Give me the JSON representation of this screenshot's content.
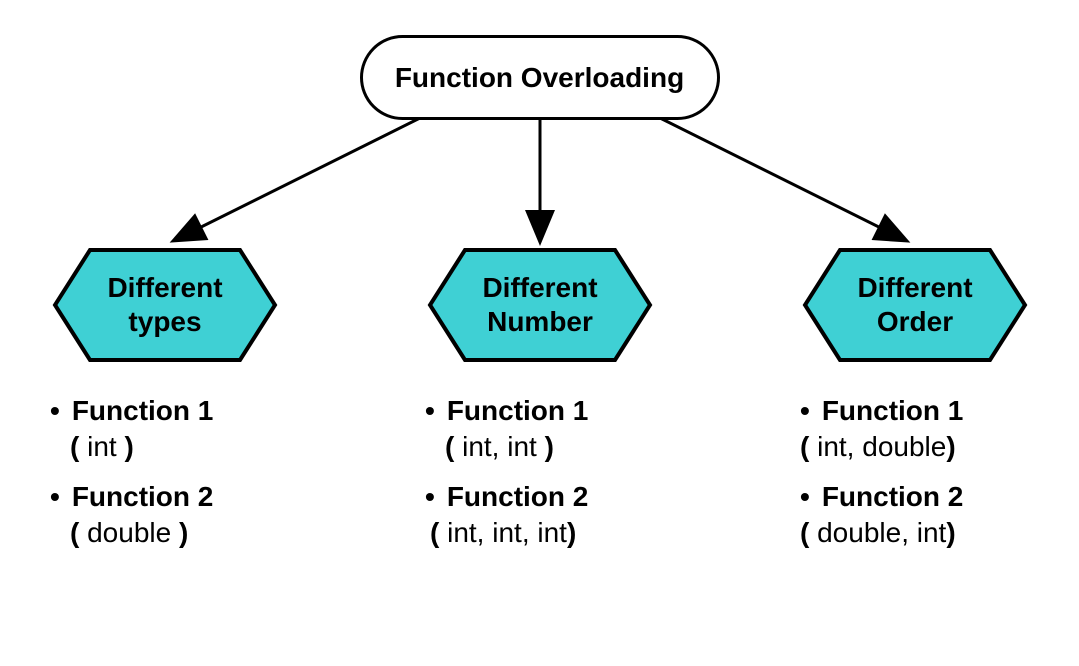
{
  "root": {
    "title": "Function Overloading"
  },
  "columns": [
    {
      "header": "Different\ntypes",
      "items": [
        {
          "name": "Function 1",
          "params": "int"
        },
        {
          "name": "Function 2",
          "params": "double"
        }
      ]
    },
    {
      "header": "Different\nNumber",
      "items": [
        {
          "name": "Function 1",
          "params": "int, int"
        },
        {
          "name": "Function 2",
          "params": "int, int,  int"
        }
      ]
    },
    {
      "header": "Different\nOrder",
      "items": [
        {
          "name": "Function 1",
          "params": "int, double"
        },
        {
          "name": "Function 2",
          "params": "double, int"
        }
      ]
    }
  ],
  "styles": {
    "hexFill": "#3fd0d4",
    "hexStroke": "#000000"
  }
}
